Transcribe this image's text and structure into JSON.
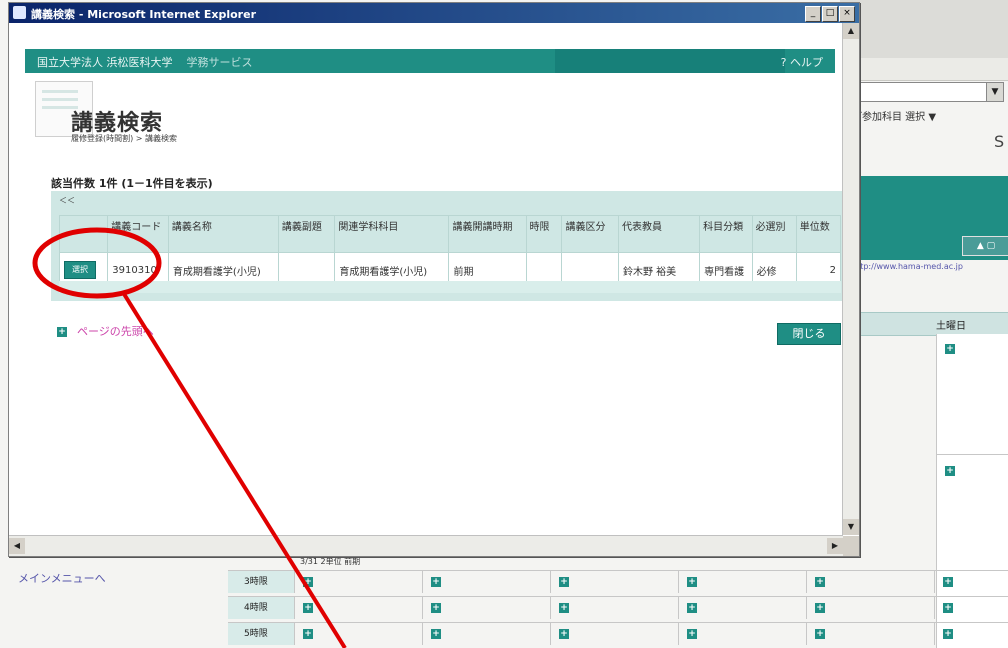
{
  "window": {
    "title": "講義検索 - Microsoft Internet Explorer",
    "controls": [
      "_",
      "□",
      "×"
    ]
  },
  "site_header": {
    "brand": "国立大学法人 浜松医科大学",
    "service": "学務サービス",
    "help": "? ヘルプ"
  },
  "page": {
    "title": "講義検索",
    "breadcrumb": "履修登録(時間割) > 講義検索"
  },
  "results": {
    "count_text": "該当件数 1件 (1－1件目を表示)",
    "pager_text": "＜＜",
    "headers": [
      "",
      "講義コード",
      "講義名称",
      "講義副題",
      "関連学科科目",
      "講義開講時期",
      "時限",
      "講義区分",
      "代表教員",
      "科目分類",
      "必選別",
      "単位数"
    ],
    "rows": [
      {
        "select_label": "選択",
        "code": "3910310",
        "name": "育成期看護学(小児)",
        "subtitle": "",
        "related": "育成期看護学(小児)",
        "period": "前期",
        "slot": "",
        "category": "",
        "teacher": "鈴木野 裕美",
        "classification": "専門看護",
        "required": "必修",
        "credits": "2"
      }
    ]
  },
  "links": {
    "page_top": "ページの先頭へ",
    "close": "閉じる"
  },
  "background": {
    "right_text": "ご参加科目 選択 ▼",
    "s_glyph": "S",
    "right_link": "http://www.hama-med.ac.jp",
    "saturday_header": "土曜日",
    "left_nav": "メインメニューへ",
    "small_text": "3/31 2単位 前期",
    "period_labels": [
      "3時限",
      "4時限",
      "5時限"
    ]
  },
  "annotation": {
    "color": "#e00000"
  }
}
